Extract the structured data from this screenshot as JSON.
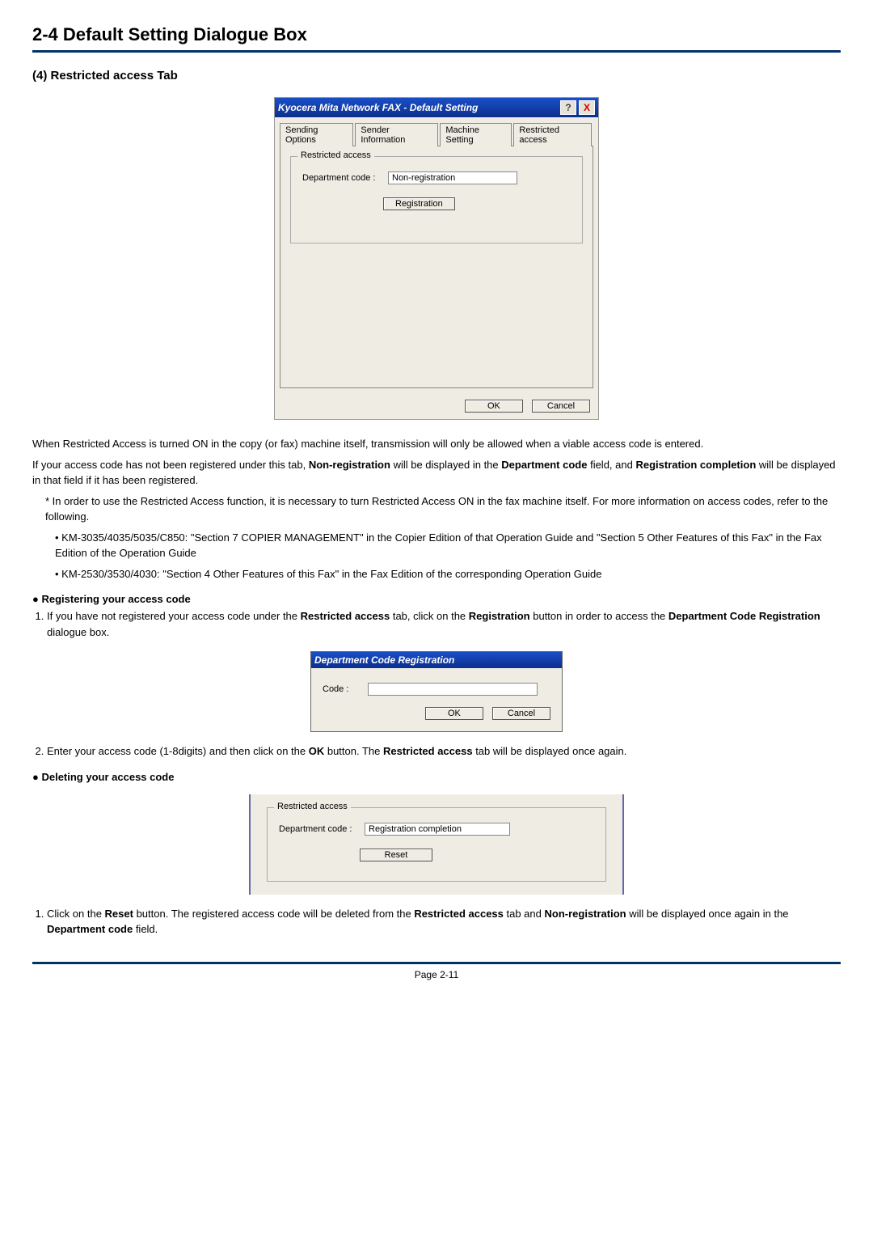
{
  "section": {
    "title": "2-4  Default Setting Dialogue Box",
    "subsection": "(4) Restricted access Tab"
  },
  "dialog1": {
    "title": "Kyocera Mita Network FAX - Default Setting",
    "help": "?",
    "close": "X",
    "tabs": {
      "t1": "Sending Options",
      "t2": "Sender Information",
      "t3": "Machine Setting",
      "t4": "Restricted access"
    },
    "group_title": "Restricted access",
    "dept_label": "Department code :",
    "dept_value": "Non-registration",
    "reg_btn": "Registration",
    "ok": "OK",
    "cancel": "Cancel"
  },
  "body": {
    "p1a": "When Restricted Access is turned ON in the copy (or fax) machine itself, transmission will only be allowed when a viable access code is entered.",
    "p1b_pre": "If your access code has not been registered under this tab, ",
    "p1b_b1": "Non-registration",
    "p1b_mid1": " will be displayed in the ",
    "p1b_b2": "Department code",
    "p1b_mid2": " field, and ",
    "p1b_b3": "Registration completion",
    "p1b_end": " will be displayed in that field if it has been registered.",
    "p2": "* In order to use the Restricted Access function, it is necessary to turn Restricted Access ON in the fax machine itself. For more information on access codes, refer to the following.",
    "p3": "• KM-3035/4035/5035/C850: \"Section 7  COPIER MANAGEMENT\" in the Copier Edition of that Operation Guide and \"Section 5  Other Features of this Fax\" in the Fax Edition of the Operation Guide",
    "p4": "• KM-2530/3530/4030: \"Section 4  Other Features of this Fax\" in the Fax Edition of the corresponding Operation Guide",
    "h1": "Registering your access code",
    "s1_pre": "If you have not registered your access code under the ",
    "s1_b1": "Restricted access",
    "s1_mid1": " tab, click on the ",
    "s1_b2": "Registration",
    "s1_mid2": " button in order to access the ",
    "s1_b3": "Department Code Registration",
    "s1_end": " dialogue box.",
    "s2_pre": "Enter your access code (1-8digits) and then click on the ",
    "s2_b1": "OK",
    "s2_mid": " button. The ",
    "s2_b2": "Restricted access",
    "s2_end": " tab will be displayed once again.",
    "h2": "Deleting your access code",
    "d1_pre": "Click on the ",
    "d1_b1": "Reset",
    "d1_mid1": " button. The registered access code will be deleted from the ",
    "d1_b2": "Restricted access",
    "d1_mid2": " tab and ",
    "d1_b3": "Non-registration",
    "d1_mid3": " will be displayed once again in the ",
    "d1_b4": "Department code",
    "d1_end": " field."
  },
  "dialog2": {
    "title": "Department Code Registration",
    "code_label": "Code :",
    "code_value": "",
    "ok": "OK",
    "cancel": "Cancel"
  },
  "dialog3": {
    "group_title": "Restricted access",
    "dept_label": "Department code :",
    "dept_value": "Registration completion",
    "reset_btn": "Reset"
  },
  "footer": "Page 2-11"
}
